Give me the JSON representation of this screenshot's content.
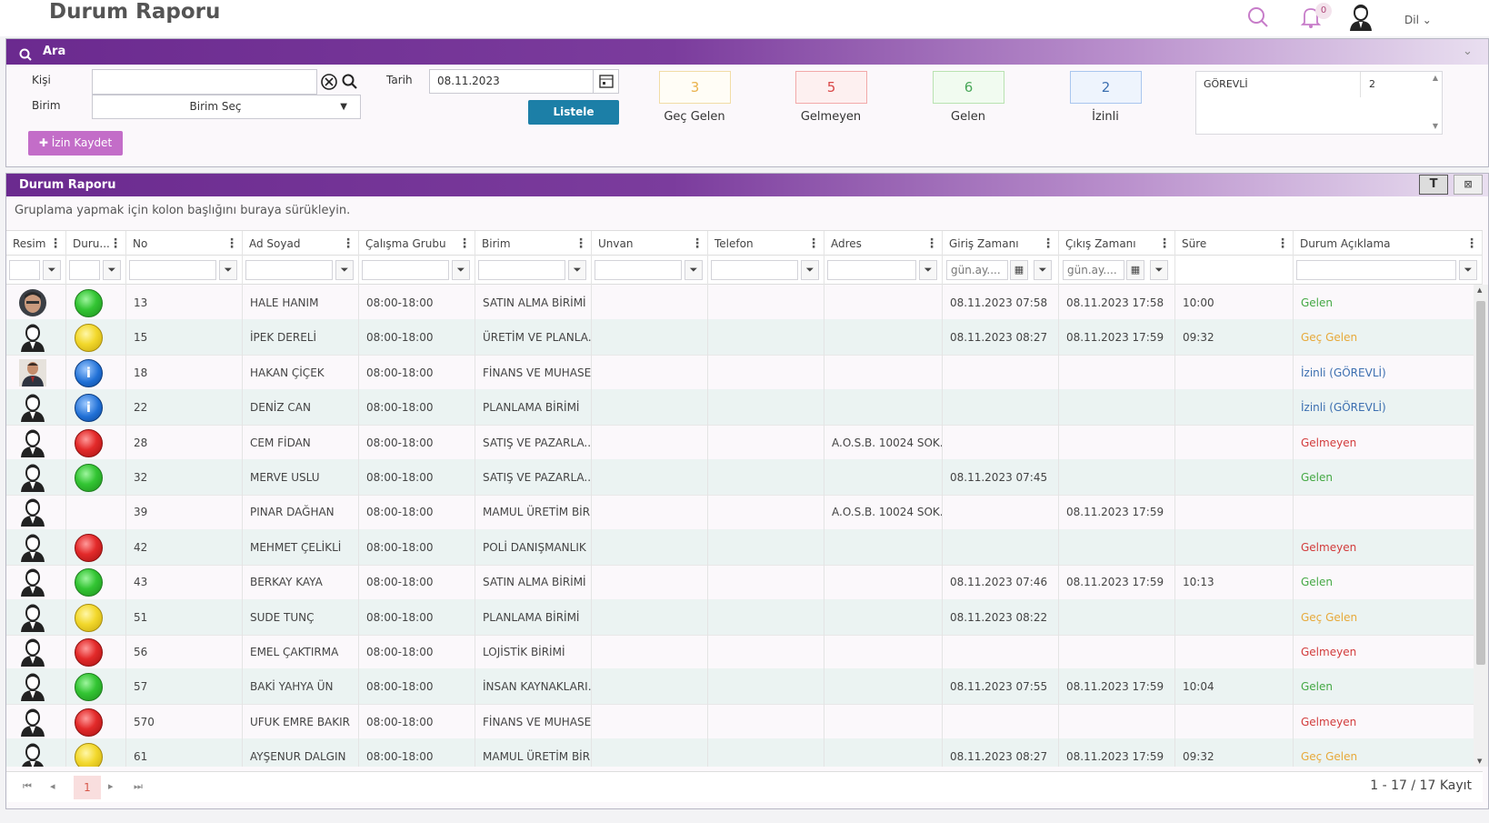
{
  "header": {
    "title": "Durum Raporu",
    "notif_count": "0",
    "lang": "Dil"
  },
  "search": {
    "title": "Ara",
    "kisi_label": "Kişi",
    "birim_label": "Birim",
    "birim_value": "Birim Seç",
    "tarih_label": "Tarih",
    "tarih_value": "08.11.2023",
    "listele_label": "Listele",
    "izin_label": "İzin Kaydet"
  },
  "counts": [
    {
      "value": "3",
      "label": "Geç Gelen",
      "color": "#f1dca6"
    },
    {
      "value": "5",
      "label": "Gelmeyen",
      "color": "#f2a9a9"
    },
    {
      "value": "6",
      "label": "Gelen",
      "color": "#b9e2b1"
    },
    {
      "value": "2",
      "label": "İzinli",
      "color": "#a9c6ee"
    }
  ],
  "gorevli": {
    "label": "GÖREVLİ",
    "value": "2"
  },
  "report": {
    "title": "Durum Raporu",
    "group_hint": "Gruplama yapmak için kolon başlığını buraya sürükleyin.",
    "columns": [
      "Resim",
      "Duru...",
      "No",
      "Ad Soyad",
      "Çalışma Grubu",
      "Birim",
      "Unvan",
      "Telefon",
      "Adres",
      "Giriş Zamanı",
      "Çıkış Zamanı",
      "Süre",
      "Durum Açıklama"
    ],
    "date_placeholder": "gün.ay....",
    "rows": [
      {
        "avatar": "photo1",
        "status": "green",
        "no": "13",
        "name": "HALE HANIM",
        "group": "08:00-18:00",
        "unit": "SATIN ALMA BİRİMİ",
        "address": "",
        "in": "08.11.2023 07:58",
        "out": "08.11.2023 17:58",
        "dur": "10:00",
        "desc": "Gelen",
        "desc_type": "gelen"
      },
      {
        "avatar": "default",
        "status": "yellow",
        "no": "15",
        "name": "İPEK DERELİ",
        "group": "08:00-18:00",
        "unit": "ÜRETİM VE PLANLA...",
        "address": "",
        "in": "08.11.2023 08:27",
        "out": "08.11.2023 17:59",
        "dur": "09:32",
        "desc": "Geç Gelen",
        "desc_type": "gec"
      },
      {
        "avatar": "photo2",
        "status": "info",
        "no": "18",
        "name": "HAKAN ÇİÇEK",
        "group": "08:00-18:00",
        "unit": "FİNANS VE MUHASE...",
        "address": "",
        "in": "",
        "out": "",
        "dur": "",
        "desc": "İzinli (GÖREVLİ)",
        "desc_type": "izinli"
      },
      {
        "avatar": "default",
        "status": "info",
        "no": "22",
        "name": "DENİZ CAN",
        "group": "08:00-18:00",
        "unit": "PLANLAMA BİRİMİ",
        "address": "",
        "in": "",
        "out": "",
        "dur": "",
        "desc": "İzinli (GÖREVLİ)",
        "desc_type": "izinli"
      },
      {
        "avatar": "default",
        "status": "red",
        "no": "28",
        "name": "CEM FİDAN",
        "group": "08:00-18:00",
        "unit": "SATIŞ VE PAZARLA...",
        "address": "A.O.S.B. 10024 SOK...",
        "in": "",
        "out": "",
        "dur": "",
        "desc": "Gelmeyen",
        "desc_type": "gelmeyen"
      },
      {
        "avatar": "default",
        "status": "green",
        "no": "32",
        "name": "MERVE USLU",
        "group": "08:00-18:00",
        "unit": "SATIŞ VE PAZARLA...",
        "address": "",
        "in": "08.11.2023 07:45",
        "out": "",
        "dur": "",
        "desc": "Gelen",
        "desc_type": "gelen"
      },
      {
        "avatar": "default",
        "status": "none",
        "no": "39",
        "name": "PINAR DAĞHAN",
        "group": "08:00-18:00",
        "unit": "MAMUL ÜRETİM BİRİ...",
        "address": "A.O.S.B. 10024 SOK...",
        "in": "",
        "out": "08.11.2023 17:59",
        "dur": "",
        "desc": "",
        "desc_type": ""
      },
      {
        "avatar": "default",
        "status": "red",
        "no": "42",
        "name": "MEHMET ÇELİKLİ",
        "group": "08:00-18:00",
        "unit": "POLİ DANIŞMANLIK",
        "address": "",
        "in": "",
        "out": "",
        "dur": "",
        "desc": "Gelmeyen",
        "desc_type": "gelmeyen"
      },
      {
        "avatar": "default",
        "status": "green",
        "no": "43",
        "name": "BERKAY KAYA",
        "group": "08:00-18:00",
        "unit": "SATIN ALMA BİRİMİ",
        "address": "",
        "in": "08.11.2023 07:46",
        "out": "08.11.2023 17:59",
        "dur": "10:13",
        "desc": "Gelen",
        "desc_type": "gelen"
      },
      {
        "avatar": "default",
        "status": "yellow",
        "no": "51",
        "name": "SUDE TUNÇ",
        "group": "08:00-18:00",
        "unit": "PLANLAMA BİRİMİ",
        "address": "",
        "in": "08.11.2023 08:22",
        "out": "",
        "dur": "",
        "desc": "Geç Gelen",
        "desc_type": "gec"
      },
      {
        "avatar": "default",
        "status": "red",
        "no": "56",
        "name": "EMEL ÇAKTIRMA",
        "group": "08:00-18:00",
        "unit": "LOJİSTİK BİRİMİ",
        "address": "",
        "in": "",
        "out": "",
        "dur": "",
        "desc": "Gelmeyen",
        "desc_type": "gelmeyen"
      },
      {
        "avatar": "default",
        "status": "green",
        "no": "57",
        "name": "BAKİ YAHYA ÜN",
        "group": "08:00-18:00",
        "unit": "İNSAN KAYNAKLARI...",
        "address": "",
        "in": "08.11.2023 07:55",
        "out": "08.11.2023 17:59",
        "dur": "10:04",
        "desc": "Gelen",
        "desc_type": "gelen"
      },
      {
        "avatar": "default",
        "status": "red",
        "no": "570",
        "name": "UFUK EMRE BAKIR",
        "group": "08:00-18:00",
        "unit": "FİNANS VE MUHASE...",
        "address": "",
        "in": "",
        "out": "",
        "dur": "",
        "desc": "Gelmeyen",
        "desc_type": "gelmeyen"
      },
      {
        "avatar": "default",
        "status": "yellow",
        "no": "61",
        "name": "AYŞENUR DALGIN",
        "group": "08:00-18:00",
        "unit": "MAMUL ÜRETİM BİRİ...",
        "address": "",
        "in": "08.11.2023 08:27",
        "out": "08.11.2023 17:59",
        "dur": "09:32",
        "desc": "Geç Gelen",
        "desc_type": "gec"
      }
    ],
    "pager": {
      "current": "1",
      "info": "1 - 17 / 17 Kayıt"
    }
  }
}
